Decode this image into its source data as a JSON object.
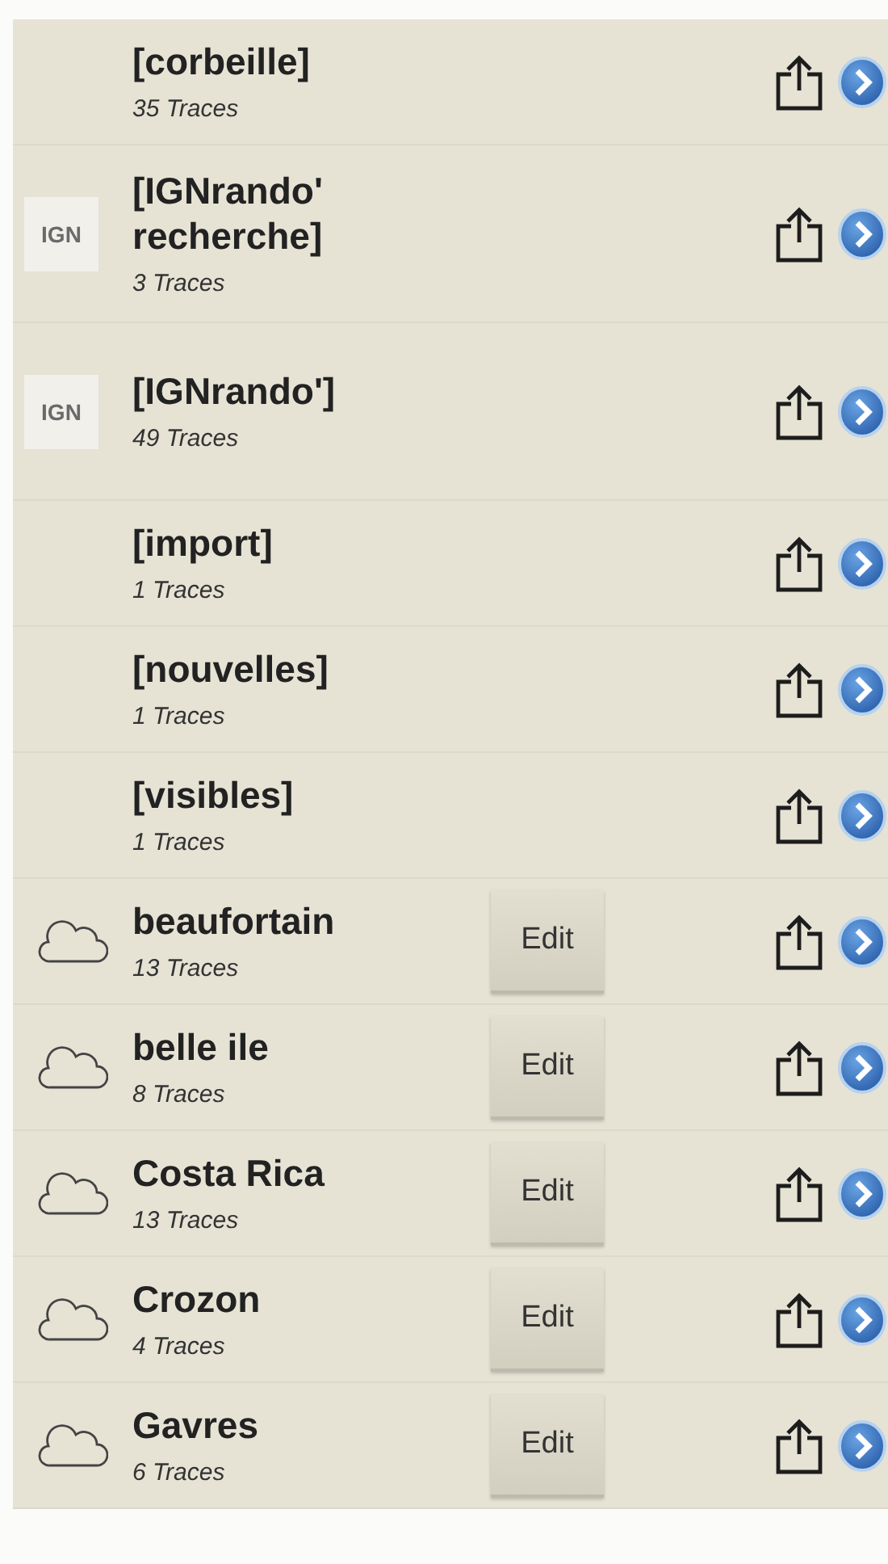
{
  "folders": [
    {
      "kind": "plain",
      "name": "[corbeille]",
      "count": "35 Traces"
    },
    {
      "kind": "ign",
      "logo_text": "IGN",
      "name": "[IGNrando' recherche]",
      "count": "3 Traces"
    },
    {
      "kind": "ign",
      "logo_text": "IGN",
      "name": "[IGNrando']",
      "count": "49 Traces"
    },
    {
      "kind": "plain",
      "name": "[import]",
      "count": "1 Traces"
    },
    {
      "kind": "plain",
      "name": "[nouvelles]",
      "count": "1 Traces"
    },
    {
      "kind": "plain",
      "name": "[visibles]",
      "count": "1 Traces"
    },
    {
      "kind": "cloud",
      "name": "beaufortain",
      "count": "13 Traces",
      "edit_label": "Edit"
    },
    {
      "kind": "cloud",
      "name": "belle ile",
      "count": "8 Traces",
      "edit_label": "Edit"
    },
    {
      "kind": "cloud",
      "name": "Costa Rica",
      "count": "13 Traces",
      "edit_label": "Edit"
    },
    {
      "kind": "cloud",
      "name": "Crozon",
      "count": "4 Traces",
      "edit_label": "Edit"
    },
    {
      "kind": "cloud",
      "name": "Gavres",
      "count": "6 Traces",
      "edit_label": "Edit"
    }
  ]
}
